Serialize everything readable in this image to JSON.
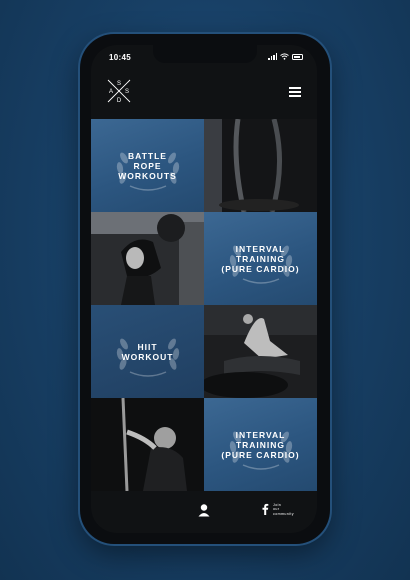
{
  "status": {
    "time": "10:45"
  },
  "header": {
    "logo_letters": [
      "S",
      "A",
      "S",
      "D"
    ]
  },
  "tiles": [
    {
      "label": "BATTLE\nROPE\nWORKOUTS"
    },
    {
      "label": "INTERVAL\nTRAINING\n(PURE CARDIO)"
    },
    {
      "label": "HIIT\nWORKOUT"
    },
    {
      "label": "INTERVAL\nTRAINING\n(PURE CARDIO)"
    }
  ],
  "footer": {
    "community_text": "Join\nour\ncommunity"
  },
  "colors": {
    "background": "#173e63",
    "tile_blue": "#2c5680",
    "screen": "#101214"
  }
}
